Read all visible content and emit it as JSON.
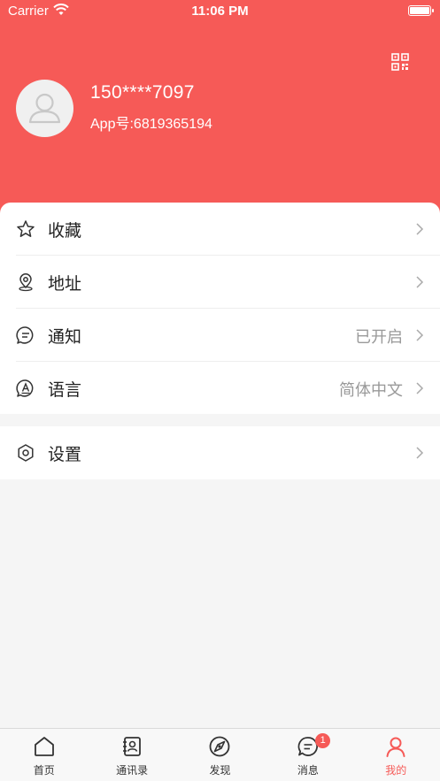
{
  "status_bar": {
    "carrier": "Carrier",
    "time": "11:06 PM"
  },
  "profile": {
    "phone": "150****7097",
    "app_id": "App号:6819365194"
  },
  "menu": [
    {
      "label": "收藏",
      "value": "",
      "icon": "star-icon"
    },
    {
      "label": "地址",
      "value": "",
      "icon": "location-pin-icon"
    },
    {
      "label": "通知",
      "value": "已开启",
      "icon": "message-bubble-icon"
    },
    {
      "label": "语言",
      "value": "简体中文",
      "icon": "language-icon"
    }
  ],
  "settings": {
    "label": "设置",
    "icon": "gear-icon"
  },
  "tabbar": {
    "items": [
      {
        "label": "首页",
        "icon": "home-icon"
      },
      {
        "label": "通讯录",
        "icon": "contacts-icon"
      },
      {
        "label": "发现",
        "icon": "compass-icon"
      },
      {
        "label": "消息",
        "icon": "chat-icon",
        "badge": "1"
      },
      {
        "label": "我的",
        "icon": "user-icon",
        "active": true
      }
    ]
  },
  "colors": {
    "accent": "#f65a57",
    "background": "#f5f5f5"
  }
}
